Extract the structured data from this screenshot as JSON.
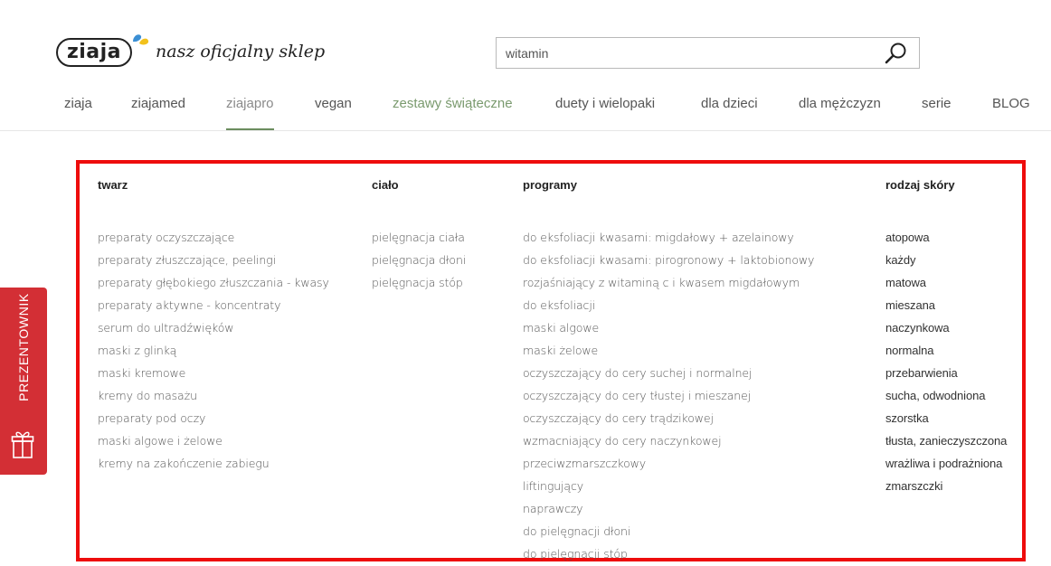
{
  "brand": {
    "logo_text": "ziaja",
    "tagline": "nasz oficjalny sklep"
  },
  "search": {
    "value": "witamin",
    "icon": "search-icon"
  },
  "nav": {
    "items": [
      {
        "label": "ziaja"
      },
      {
        "label": "ziajamed"
      },
      {
        "label": "ziajapro"
      },
      {
        "label": "vegan"
      },
      {
        "label": "zestawy świąteczne"
      },
      {
        "label": "duety i wielopaki"
      },
      {
        "label": "dla dzieci"
      },
      {
        "label": "dla mężczyzn"
      },
      {
        "label": "serie"
      },
      {
        "label": "BLOG"
      }
    ],
    "active": "ziajapro"
  },
  "menu": {
    "columns": [
      {
        "heading": "twarz",
        "items": [
          "preparaty oczyszczające",
          "preparaty złuszczające, peelingi",
          "preparaty głębokiego złuszczania - kwasy",
          "preparaty aktywne - koncentraty",
          "serum do ultradźwięków",
          "maski z glinką",
          "maski kremowe",
          "kremy do masażu",
          "preparaty pod oczy",
          "maski algowe i żelowe",
          "kremy na zakończenie zabiegu"
        ]
      },
      {
        "heading": "ciało",
        "items": [
          "pielęgnacja ciała",
          "pielęgnacja dłoni",
          "pielęgnacja stóp"
        ]
      },
      {
        "heading": "programy",
        "items": [
          "do eksfoliacji kwasami: migdałowy + azelainowy",
          "do eksfoliacji kwasami: pirogronowy + laktobionowy",
          "rozjaśniający z witaminą c i kwasem migdałowym",
          "do eksfoliacji",
          "maski algowe",
          "maski żelowe",
          "oczyszczający do cery suchej i normalnej",
          "oczyszczający do cery tłustej i mieszanej",
          "oczyszczający do cery trądzikowej",
          "wzmacniający do cery naczynkowej",
          "przeciwzmarszczkowy",
          "liftingujący",
          "naprawczy",
          "do pielęgnacji dłoni",
          "do pielęgnacji stóp"
        ]
      },
      {
        "heading": "rodzaj skóry",
        "items": [
          "atopowa",
          "każdy",
          "matowa",
          "mieszana",
          "naczynkowa",
          "normalna",
          "przebarwienia",
          "sucha, odwodniona",
          "szorstka",
          "tłusta, zanieczyszczona",
          "wrażliwa i podrażniona",
          "zmarszczki"
        ]
      }
    ]
  },
  "side_tab": {
    "label": "PREZENTOWNIK",
    "icon": "gift-icon"
  },
  "colors": {
    "highlight_border": "#ee0c0c",
    "side_tab": "#d32f35",
    "nav_active_underline": "#6b8d5e"
  }
}
